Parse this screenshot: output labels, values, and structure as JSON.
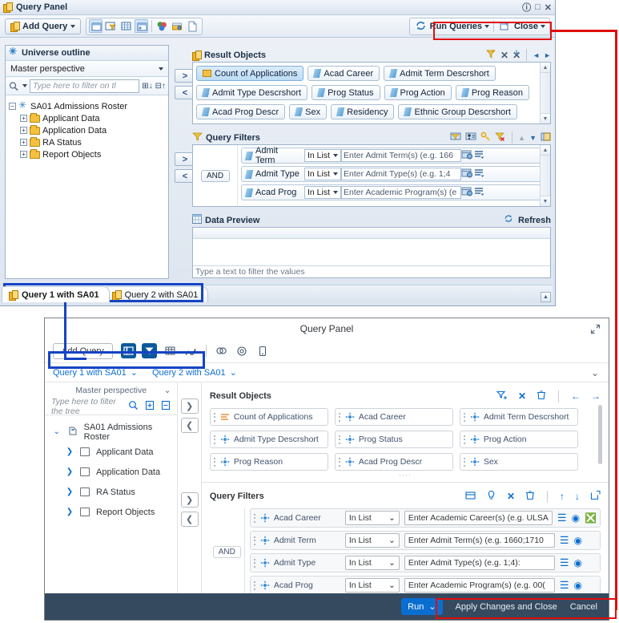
{
  "top_window": {
    "title": "Query Panel",
    "title_buttons": [
      "help",
      "maximize",
      "close"
    ],
    "toolbar": {
      "add_query_label": "Add Query",
      "view_icons": [
        "panel-layout-icon",
        "filter-view-icon",
        "grid-view-icon",
        "split-view-icon"
      ],
      "extra_icons": [
        "scope-of-analysis-icon",
        "query-properties-icon",
        "sql-viewer-icon"
      ],
      "run_queries_label": "Run Queries",
      "close_label": "Close"
    },
    "universe": {
      "header": "Universe outline",
      "perspective": "Master perspective",
      "filter_placeholder": "Type here to filter on tl",
      "root": "SA01 Admissions Roster",
      "folders": [
        "Applicant Data",
        "Application Data",
        "RA Status",
        "Report Objects"
      ]
    },
    "result_objects": {
      "header": "Result Objects",
      "tool_icons": [
        "add-filter-icon",
        "remove-icon",
        "remove-all-icon",
        "prev-icon",
        "next-icon"
      ],
      "objects": [
        {
          "label": "Count of Applications",
          "kind": "measure",
          "selected": true
        },
        {
          "label": "Acad Career",
          "kind": "dimension",
          "selected": false
        },
        {
          "label": "Admit Term Descrshort",
          "kind": "dimension",
          "selected": false
        },
        {
          "label": "Admit Type Descrshort",
          "kind": "dimension",
          "selected": false
        },
        {
          "label": "Prog Status",
          "kind": "dimension",
          "selected": false
        },
        {
          "label": "Prog Action",
          "kind": "dimension",
          "selected": false
        },
        {
          "label": "Prog Reason",
          "kind": "dimension",
          "selected": false
        },
        {
          "label": "Acad Prog Descr",
          "kind": "dimension",
          "selected": false
        },
        {
          "label": "Sex",
          "kind": "dimension",
          "selected": false
        },
        {
          "label": "Residency",
          "kind": "dimension",
          "selected": false
        },
        {
          "label": "Ethnic Group Descrshort",
          "kind": "dimension",
          "selected": false
        }
      ]
    },
    "query_filters": {
      "header": "Query Filters",
      "tool_icons": [
        "add-filter-icon",
        "add-subquery-icon",
        "add-prompt-icon",
        "remove-filter-icon",
        "move-up-icon",
        "move-down-icon",
        "expand-icon"
      ],
      "operator": "AND",
      "rows": [
        {
          "name": "Admit Term",
          "operator": "In List",
          "value": "Enter Admit Term(s) (e.g. 166"
        },
        {
          "name": "Admit Type",
          "operator": "In List",
          "value": "Enter Admit Type(s) (e.g. 1;4"
        },
        {
          "name": "Acad Prog",
          "operator": "In List",
          "value": "Enter Academic Program(s) (e"
        }
      ]
    },
    "data_preview": {
      "header": "Data Preview",
      "refresh_label": "Refresh",
      "filter_placeholder": "Type a text to filter the values"
    },
    "query_tabs": [
      {
        "label": "Query 1 with SA01",
        "active": true
      },
      {
        "label": "Query 2 with SA01",
        "active": false
      }
    ]
  },
  "bottom_window": {
    "title": "Query Panel",
    "expand_icon": "expand-icon",
    "toolbar": {
      "add_query_label": "Add Query",
      "icons": [
        "panel-layout-icon",
        "filter-view-icon",
        "grid-view-icon",
        "data-preview-icon",
        "scope-of-analysis-icon",
        "query-properties-icon",
        "sql-viewer-icon"
      ]
    },
    "query_tabs": [
      {
        "label": "Query 1 with SA01"
      },
      {
        "label": "Query 2 with SA01"
      }
    ],
    "universe": {
      "perspective": "Master perspective",
      "filter_placeholder": "Type here to filter the tree",
      "root": "SA01 Admissions Roster",
      "folders": [
        "Applicant Data",
        "Application Data",
        "RA Status",
        "Report Objects"
      ]
    },
    "result_objects": {
      "header": "Result Objects",
      "tool_icons": [
        "add-filter-icon",
        "remove-icon",
        "delete-icon",
        "prev-icon",
        "next-icon"
      ],
      "objects": [
        {
          "label": "Count of Applications",
          "kind": "measure"
        },
        {
          "label": "Acad Career",
          "kind": "dimension"
        },
        {
          "label": "Admit Term Descrshort",
          "kind": "dimension"
        },
        {
          "label": "Admit Type Descrshort",
          "kind": "dimension"
        },
        {
          "label": "Prog Status",
          "kind": "dimension"
        },
        {
          "label": "Prog Action",
          "kind": "dimension"
        },
        {
          "label": "Prog Reason",
          "kind": "dimension"
        },
        {
          "label": "Acad Prog Descr",
          "kind": "dimension"
        },
        {
          "label": "Sex",
          "kind": "dimension"
        }
      ]
    },
    "query_filters": {
      "header": "Query Filters",
      "tool_icons": [
        "add-filter-icon",
        "add-prompt-icon",
        "remove-icon",
        "delete-icon",
        "move-up-icon",
        "move-down-icon",
        "expand-icon"
      ],
      "operator": "AND",
      "rows": [
        {
          "name": "Acad Career",
          "operator": "In List",
          "value": "Enter Academic Career(s) (e.g. ULSA",
          "has_clear": true
        },
        {
          "name": "Admit Term",
          "operator": "In List",
          "value": "Enter Admit Term(s) (e.g. 1660;1710",
          "has_clear": false
        },
        {
          "name": "Admit Type",
          "operator": "In List",
          "value": "Enter Admit Type(s) (e.g. 1;4):",
          "has_clear": false
        },
        {
          "name": "Acad Prog",
          "operator": "In List",
          "value": "Enter Academic Program(s) (e.g. 00(",
          "has_clear": false
        }
      ]
    },
    "footer": {
      "run_label": "Run",
      "apply_label": "Apply Changes and Close",
      "cancel_label": "Cancel"
    }
  },
  "colors": {
    "highlight_red": "#e10e0e",
    "highlight_blue": "#1544c4",
    "accent_blue": "#0a6ed1",
    "footer_dark": "#354a5f"
  }
}
